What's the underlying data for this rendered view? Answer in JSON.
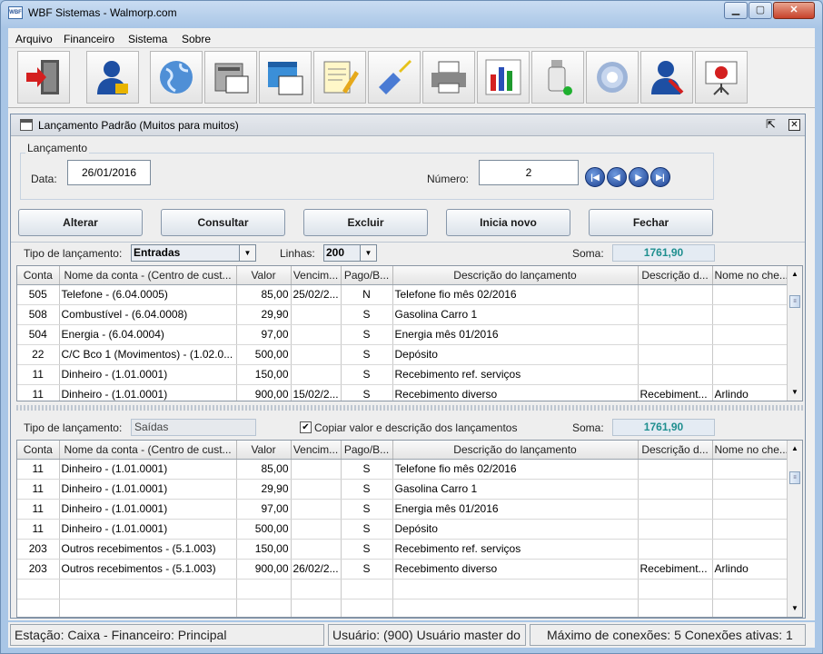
{
  "window": {
    "title": "WBF Sistemas - Walmorp.com",
    "icon_text": "WBF",
    "min": "▁",
    "max": "▢",
    "close": "✕"
  },
  "menu": [
    "Arquivo",
    "Financeiro",
    "Sistema",
    "Sobre"
  ],
  "toolbar": [
    "exit-icon",
    "user-lock-icon",
    "globe-icon",
    "forms-icon",
    "windows-icon",
    "notepad-icon",
    "cleaning-brush-icon",
    "printer-icon",
    "bar-chart-icon",
    "usb-drive-icon",
    "gear-icon",
    "user-tools-icon",
    "presentation-chart-icon"
  ],
  "form": {
    "title": "Lançamento Padrão (Muitos para muitos)",
    "legend": "Lançamento",
    "data_label": "Data:",
    "data_value": "26/01/2016",
    "numero_label": "Número:",
    "numero_value": "2",
    "nav": [
      "|◀",
      "◀",
      "▶",
      "▶|"
    ],
    "buttons": [
      "Alterar",
      "Consultar",
      "Excluir",
      "Inicia novo",
      "Fechar"
    ],
    "top": {
      "tipo_label": "Tipo de lançamento:",
      "tipo_value": "Entradas",
      "linhas_label": "Linhas:",
      "linhas_value": "200",
      "soma_label": "Soma:",
      "soma_value": "1761,90"
    },
    "bottom": {
      "tipo_label": "Tipo de lançamento:",
      "tipo_value": "Saídas",
      "copiar_label": "Copiar valor e descrição dos lançamentos",
      "copiar_mark": "✔",
      "soma_label": "Soma:",
      "soma_value": "1761,90"
    },
    "columns": [
      "Conta",
      "Nome da conta - (Centro de cust...",
      "Valor",
      "Vencim...",
      "Pago/B...",
      "Descrição do lançamento",
      "Descrição d...",
      "Nome no che..."
    ],
    "rows_top": [
      [
        "505",
        "Telefone - (6.04.0005)",
        "85,00",
        "25/02/2...",
        "N",
        " Telefone fio mês 02/2016",
        "",
        ""
      ],
      [
        "508",
        "Combustível - (6.04.0008)",
        "29,90",
        "",
        "S",
        "Gasolina Carro 1",
        "",
        ""
      ],
      [
        "504",
        "Energia - (6.04.0004)",
        "97,00",
        "",
        "S",
        "Energia mês 01/2016",
        "",
        ""
      ],
      [
        "22",
        "C/C Bco 1 (Movimentos) - (1.02.0...",
        "500,00",
        "",
        "S",
        "Depósito",
        "",
        ""
      ],
      [
        "11",
        "Dinheiro - (1.01.0001)",
        "150,00",
        "",
        "S",
        "Recebimento ref. serviços",
        "",
        ""
      ],
      [
        "11",
        "Dinheiro - (1.01.0001)",
        "900,00",
        "15/02/2...",
        "S",
        "Recebimento diverso",
        "Recebiment...",
        "Arlindo"
      ]
    ],
    "rows_bottom": [
      [
        "11",
        "Dinheiro - (1.01.0001)",
        "85,00",
        "",
        "S",
        " Telefone fio mês 02/2016",
        "",
        ""
      ],
      [
        "11",
        "Dinheiro - (1.01.0001)",
        "29,90",
        "",
        "S",
        "Gasolina Carro 1",
        "",
        ""
      ],
      [
        "11",
        "Dinheiro - (1.01.0001)",
        "97,00",
        "",
        "S",
        "Energia mês 01/2016",
        "",
        ""
      ],
      [
        "11",
        "Dinheiro - (1.01.0001)",
        "500,00",
        "",
        "S",
        "Depósito",
        "",
        ""
      ],
      [
        "203",
        "Outros recebimentos - (5.1.003)",
        "150,00",
        "",
        "S",
        "Recebimento ref. serviços",
        "",
        ""
      ],
      [
        "203",
        "Outros recebimentos - (5.1.003)",
        "900,00",
        "26/02/2...",
        "S",
        "Recebimento diverso",
        "Recebiment...",
        "Arlindo"
      ],
      [
        "",
        "",
        "",
        "",
        "",
        "",
        "",
        ""
      ],
      [
        "",
        "",
        "",
        "",
        "",
        "",
        "",
        ""
      ]
    ]
  },
  "status": [
    "Estação: Caixa - Financeiro: Principal",
    "Usuário: (900) Usuário master do",
    "Máximo de conexões: 5 Conexões ativas: 1"
  ],
  "colors": {
    "soma": "#1f8f8f",
    "title_bar": "#a9c6e6"
  }
}
